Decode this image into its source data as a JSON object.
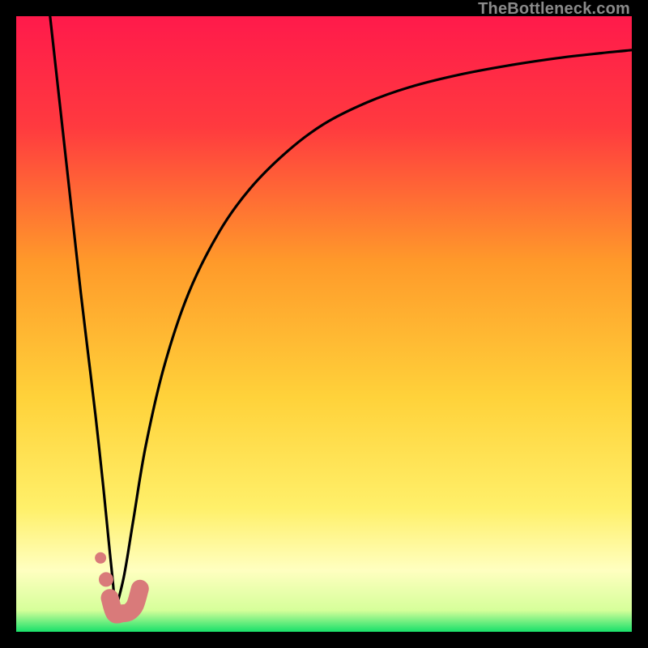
{
  "watermark": "TheBottleneck.com",
  "colors": {
    "background_black": "#000000",
    "gradient_top": "#ff1a4b",
    "gradient_mid1": "#ff7a2a",
    "gradient_mid2": "#ffd23a",
    "gradient_pale": "#ffffa8",
    "gradient_green": "#18e06a",
    "curve": "#000000",
    "marker_fill": "#d97a7a",
    "marker_stroke": "#b85f57"
  },
  "chart_data": {
    "type": "line",
    "title": "",
    "xlabel": "",
    "ylabel": "",
    "xlim": [
      0,
      100
    ],
    "ylim": [
      0,
      100
    ],
    "series": [
      {
        "name": "left-branch",
        "x": [
          5.5,
          6.5,
          7.5,
          8.5,
          9.5,
          10.5,
          11.7,
          12.9,
          14.1,
          15.1,
          15.8,
          16.0
        ],
        "y": [
          100,
          91,
          82,
          73,
          64,
          55,
          45,
          35,
          24,
          14,
          7,
          3
        ]
      },
      {
        "name": "right-branch",
        "x": [
          16.0,
          17.5,
          19,
          21,
          24,
          28,
          33,
          38,
          44,
          50,
          57,
          64,
          72,
          80,
          88,
          95,
          100
        ],
        "y": [
          3,
          9,
          18,
          30,
          43,
          55,
          65,
          72,
          78,
          82.5,
          86,
          88.5,
          90.5,
          92,
          93.2,
          94,
          94.5
        ]
      }
    ],
    "markers": {
      "name": "highlight-points",
      "shape": "J",
      "x": [
        13.7,
        14.6,
        15.2,
        16.0,
        17.2,
        18.3,
        19.3,
        20.1
      ],
      "y": [
        12.0,
        8.5,
        5.5,
        3.0,
        3.0,
        3.2,
        4.3,
        7.0
      ]
    },
    "gradient_stops": [
      {
        "pos": 0.0,
        "color": "#ff1a4b"
      },
      {
        "pos": 0.18,
        "color": "#ff3a3f"
      },
      {
        "pos": 0.4,
        "color": "#ff9a2a"
      },
      {
        "pos": 0.62,
        "color": "#ffd23a"
      },
      {
        "pos": 0.8,
        "color": "#fff06a"
      },
      {
        "pos": 0.9,
        "color": "#ffffc0"
      },
      {
        "pos": 0.965,
        "color": "#d6ff9a"
      },
      {
        "pos": 1.0,
        "color": "#18e06a"
      }
    ]
  }
}
